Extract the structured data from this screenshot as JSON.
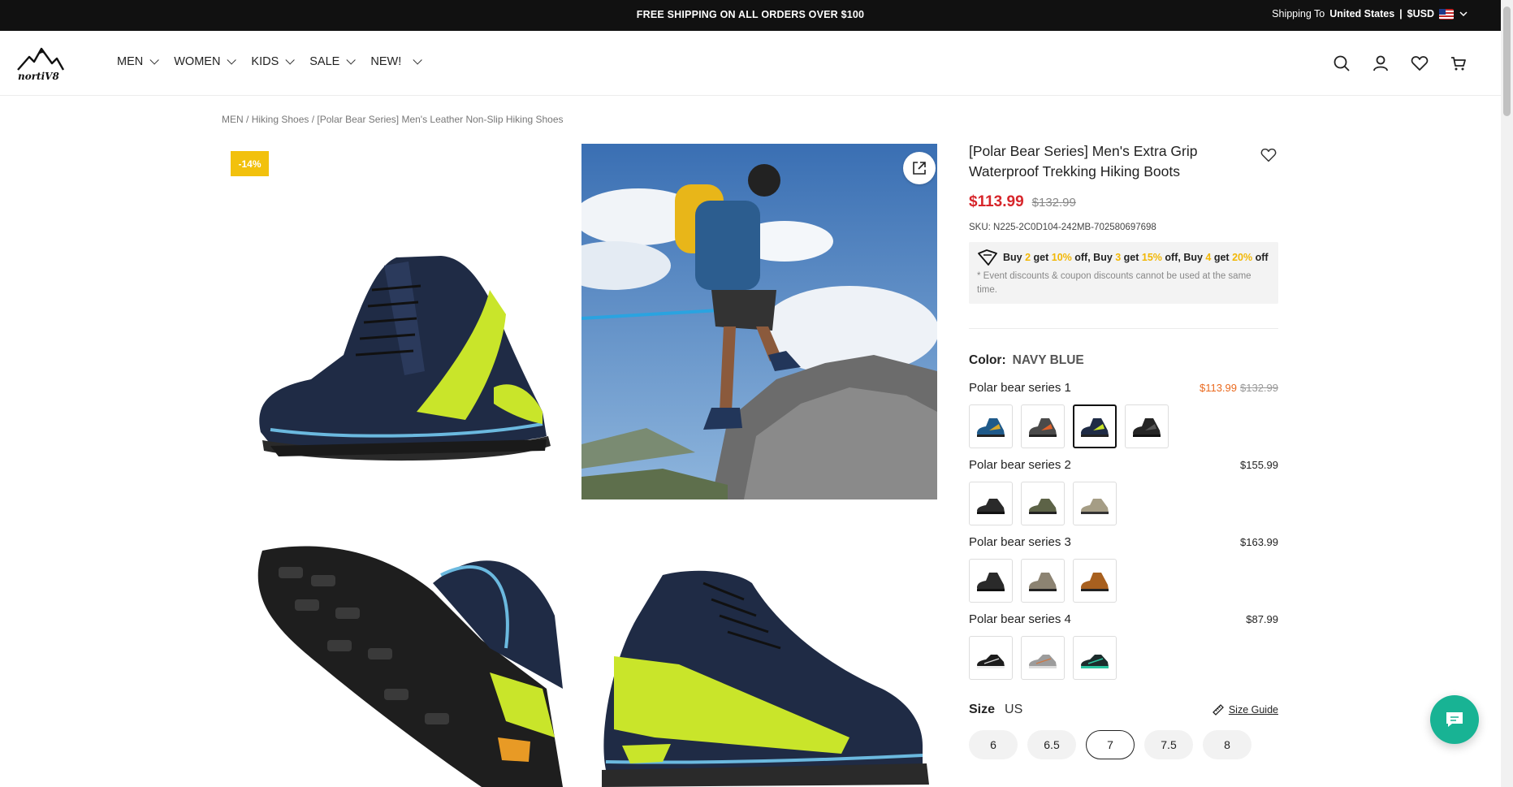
{
  "topbar": {
    "promo_prefix": "FREE SHIPPING ON ALL ORDERS OVER ",
    "promo_amount": "$100",
    "ship_label": "Shipping To",
    "ship_country": "United States",
    "separator": "|",
    "currency": "$USD"
  },
  "brand": {
    "logo_text": "nortiV8"
  },
  "nav": {
    "items": [
      {
        "label": "MEN"
      },
      {
        "label": "WOMEN"
      },
      {
        "label": "KIDS"
      },
      {
        "label": "SALE"
      },
      {
        "label": "NEW!"
      }
    ]
  },
  "breadcrumb": {
    "items": [
      "MEN",
      "Hiking Shoes",
      "[Polar Bear Series] Men's Leather Non-Slip Hiking Shoes"
    ],
    "sep": " / "
  },
  "gallery": {
    "discount_badge": "-14%"
  },
  "product": {
    "title": "[Polar Bear Series] Men's Extra Grip Waterproof Trekking Hiking Boots",
    "price": "$113.99",
    "old_price": "$132.99",
    "sku": "SKU: N225-2C0D104-242MB-702580697698",
    "promo": {
      "t1": "Buy ",
      "n1": "2",
      "t2": " get ",
      "p1": "10%",
      "t3": " off, Buy ",
      "n2": "3",
      "t4": " get ",
      "p2": "15%",
      "t5": " off, Buy ",
      "n3": "4",
      "t6": " get ",
      "p3": "20%",
      "t7": " off",
      "note": "* Event discounts & coupon discounts cannot be used at the same time."
    },
    "color_label": "Color:",
    "color_value": "NAVY BLUE",
    "series": [
      {
        "name": "Polar bear series 1",
        "price": "$113.99",
        "old_price": "$132.99"
      },
      {
        "name": "Polar bear series 2",
        "price": "$155.99"
      },
      {
        "name": "Polar bear series 3",
        "price": "$163.99"
      },
      {
        "name": "Polar bear series 4",
        "price": "$87.99"
      }
    ],
    "size_label": "Size",
    "size_unit": "US",
    "size_guide": "Size Guide",
    "sizes": [
      "6",
      "6.5",
      "7",
      "7.5",
      "8"
    ]
  },
  "colors": {
    "accent_red": "#d7262b",
    "promo_yellow": "#f2b705",
    "badge_yellow": "#f2c10d",
    "chat_green": "#18b394",
    "orange_price": "#ea6a1f"
  }
}
